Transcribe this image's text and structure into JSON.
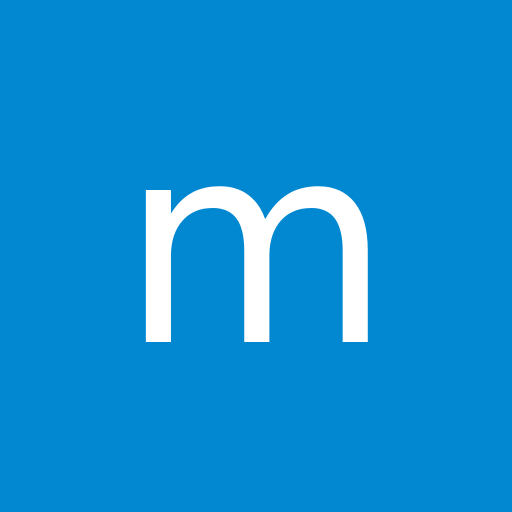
{
  "avatar": {
    "letter": "m",
    "background_color": "#0288D1",
    "letter_color": "#FFFFFF"
  }
}
